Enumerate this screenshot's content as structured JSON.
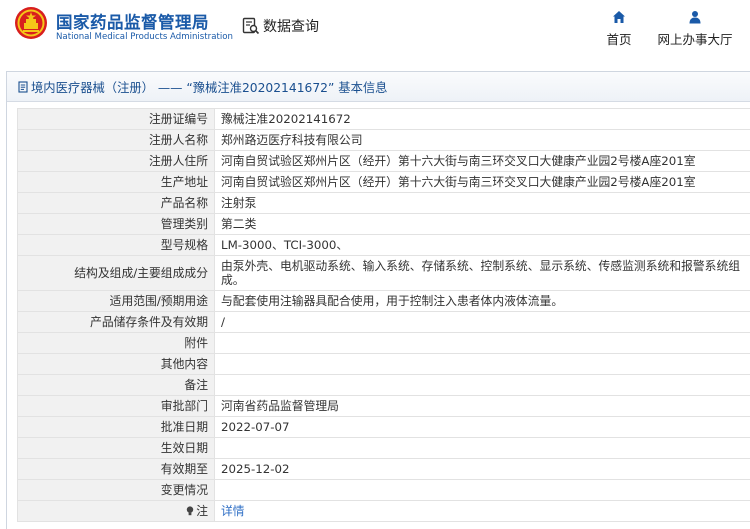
{
  "header": {
    "brand_cn": "国家药品监督管理局",
    "brand_en": "National Medical Products Administration",
    "search_label": "数据查询",
    "nav_home": "首页",
    "nav_hall": "网上办事大厅",
    "brand_color": "#1a5aa8"
  },
  "panel": {
    "title": "境内医疗器械（注册） —— “豫械注准20202141672” 基本信息"
  },
  "rows": [
    {
      "label": "注册证编号",
      "value": "豫械注准20202141672"
    },
    {
      "label": "注册人名称",
      "value": "郑州路迈医疗科技有限公司"
    },
    {
      "label": "注册人住所",
      "value": "河南自贸试验区郑州片区（经开）第十六大街与南三环交叉口大健康产业园2号楼A座201室"
    },
    {
      "label": "生产地址",
      "value": "河南自贸试验区郑州片区（经开）第十六大街与南三环交叉口大健康产业园2号楼A座201室"
    },
    {
      "label": "产品名称",
      "value": "注射泵"
    },
    {
      "label": "管理类别",
      "value": "第二类"
    },
    {
      "label": "型号规格",
      "value": "LM-3000、TCI-3000、"
    },
    {
      "label": "结构及组成/主要组成成分",
      "value": "由泵外壳、电机驱动系统、输入系统、存储系统、控制系统、显示系统、传感监测系统和报警系统组成。"
    },
    {
      "label": "适用范围/预期用途",
      "value": "与配套使用注输器具配合使用，用于控制注入患者体内液体流量。"
    },
    {
      "label": "产品储存条件及有效期",
      "value": "/"
    },
    {
      "label": "附件",
      "value": ""
    },
    {
      "label": "其他内容",
      "value": ""
    },
    {
      "label": "备注",
      "value": ""
    },
    {
      "label": "审批部门",
      "value": "河南省药品监督管理局"
    },
    {
      "label": "批准日期",
      "value": "2022-07-07"
    },
    {
      "label": "生效日期",
      "value": ""
    },
    {
      "label": "有效期至",
      "value": "2025-12-02"
    },
    {
      "label": "变更情况",
      "value": ""
    },
    {
      "label": "注",
      "value": "详情"
    }
  ]
}
